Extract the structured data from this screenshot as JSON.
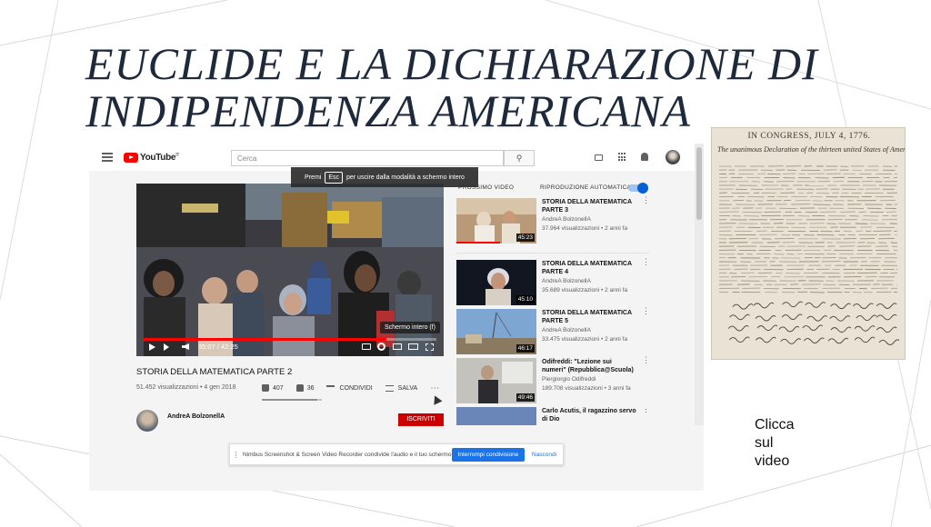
{
  "slide": {
    "title_line1": "EUCLIDE E LA DICHIARAZIONE DI",
    "title_line2": "INDIPENDENZA AMERICANA",
    "cta_lines": [
      "Clicca",
      "sul",
      "video"
    ]
  },
  "youtube": {
    "search_placeholder": "Cerca",
    "esc_tip": {
      "before": "Premi",
      "key": "Esc",
      "after": "per uscire dalla modalità a schermo intero"
    },
    "player": {
      "time": "35:07 / 42:25",
      "progress": 0.83,
      "fullscreen_tooltip": "Schermo intero (f)"
    },
    "video": {
      "title": "STORIA DELLA MATEMATICA PARTE 2",
      "meta": "51.452 visualizzazioni • 4 gen 2018",
      "likes": "407",
      "dislikes": "36",
      "share_label": "CONDIVIDI",
      "save_label": "SALVA",
      "like_ratio": 0.92
    },
    "channel": {
      "name": "AndreA BolzonellA",
      "subscribe_label": "ISCRIVITI"
    },
    "sidebar": {
      "up_next_label": "PROSSIMO VIDEO",
      "autoplay_label": "RIPRODUZIONE AUTOMATICA",
      "recommendations": [
        {
          "title": "STORIA DELLA MATEMATICA PARTE 3",
          "channel": "AndreA BolzonellA",
          "views": "37.964 visualizzazioni • 2 anni fa",
          "duration": "45:23"
        },
        {
          "title": "STORIA DELLA MATEMATICA PARTE 4",
          "channel": "AndreA BolzonellA",
          "views": "35.689 visualizzazioni • 2 anni fa",
          "duration": "45:10"
        },
        {
          "title": "STORIA DELLA MATEMATICA PARTE 5",
          "channel": "AndreA BolzonellA",
          "views": "33.475 visualizzazioni • 2 anni fa",
          "duration": "46:17"
        },
        {
          "title": "Odifreddi: \"Lezione sui numeri\" (Repubblica@Scuola)",
          "channel": "Piergiorgio Odifreddi",
          "views": "189.708 visualizzazioni • 3 anni fa",
          "duration": "49:46"
        },
        {
          "title": "Carlo Acutis, il ragazzino servo di Dio",
          "channel": "",
          "views": "",
          "duration": ""
        }
      ]
    }
  },
  "share_bar": {
    "message": "Nimbus Screenshot & Screen Video Recorder condivide l'audio e il tuo schermo.",
    "stop_label": "Interrompi condivisione",
    "hide_label": "Nascondi"
  },
  "declaration": {
    "header": "IN CONGRESS, JULY 4, 1776.",
    "subtitle": "The unanimous Declaration of the thirteen united States of America,"
  }
}
